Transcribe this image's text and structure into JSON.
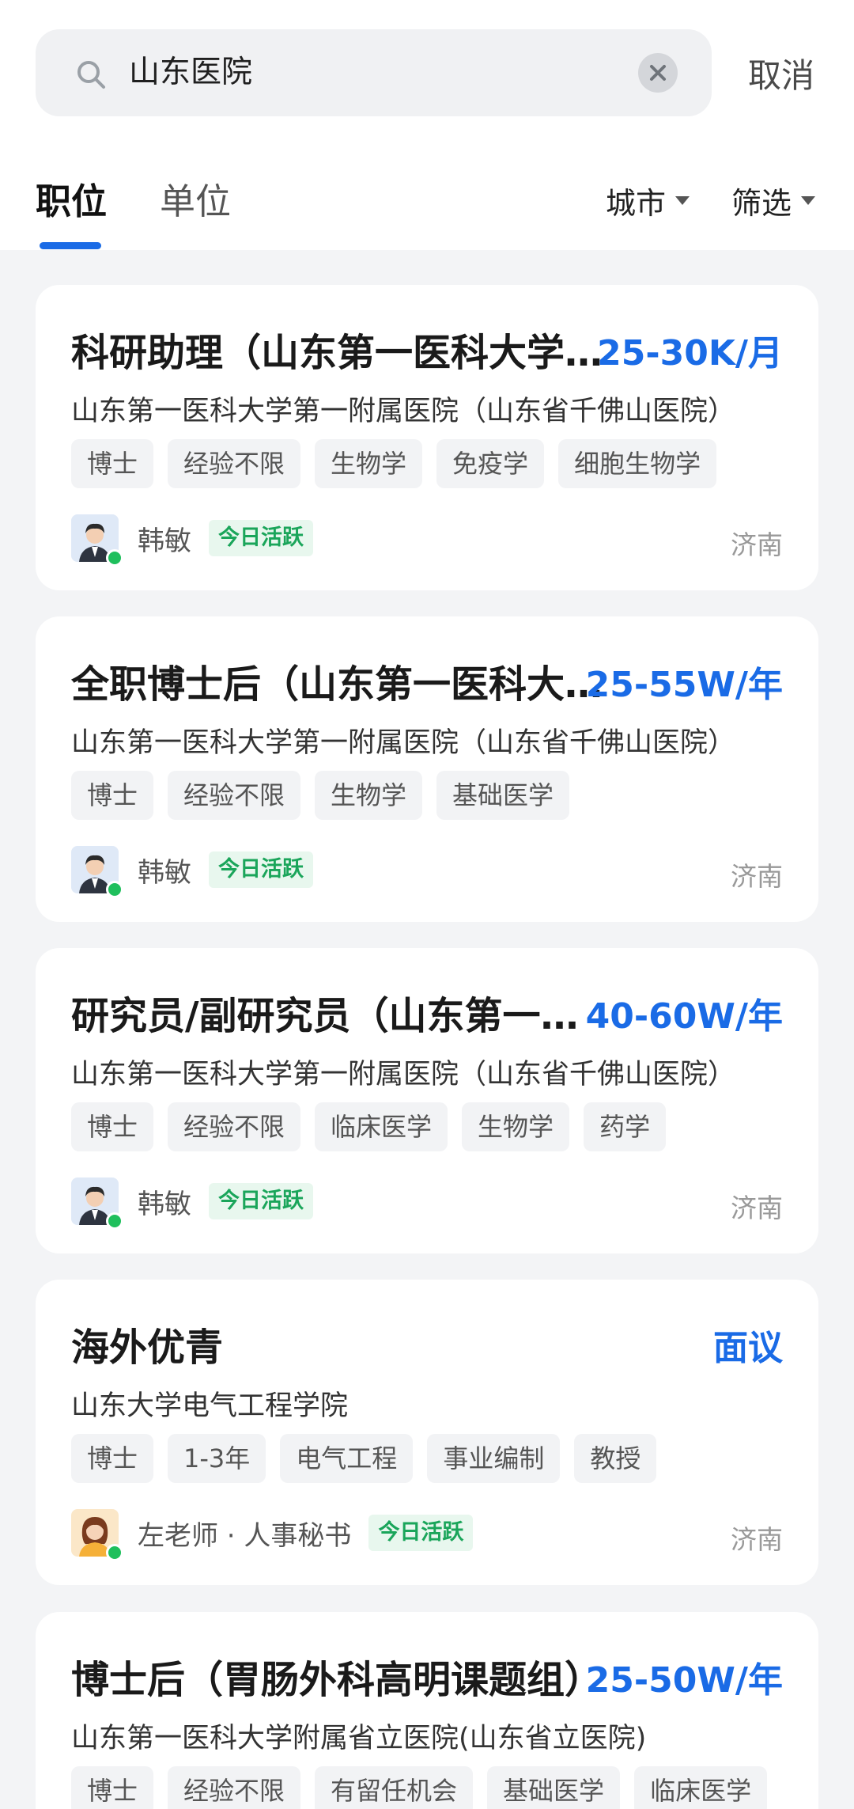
{
  "search": {
    "query": "山东医院",
    "cancel_label": "取消"
  },
  "tabs": [
    {
      "label": "职位",
      "active": true
    },
    {
      "label": "单位",
      "active": false
    }
  ],
  "filters": {
    "city_label": "城市",
    "filter_label": "筛选"
  },
  "colors": {
    "accent": "#1a6be6",
    "active_green": "#1aa55a",
    "online_dot": "#1fbf5c"
  },
  "jobs": [
    {
      "title": "科研助理（山东第一医科大学第一附属医院）",
      "salary": "25-30K/月",
      "org": "山东第一医科大学第一附属医院（山东省千佛山医院）",
      "tags": [
        "博士",
        "经验不限",
        "生物学",
        "免疫学",
        "细胞生物学"
      ],
      "recruiter": "韩敏",
      "avatar_icon": "male-avatar-icon",
      "active_badge": "今日活跃",
      "city": "济南"
    },
    {
      "title": "全职博士后（山东第一医科大学第一附属医院）",
      "salary": "25-55W/年",
      "org": "山东第一医科大学第一附属医院（山东省千佛山医院）",
      "tags": [
        "博士",
        "经验不限",
        "生物学",
        "基础医学"
      ],
      "recruiter": "韩敏",
      "avatar_icon": "male-avatar-icon",
      "active_badge": "今日活跃",
      "city": "济南"
    },
    {
      "title": "研究员/副研究员（山东第一医科大学第一附属医院）",
      "salary": "40-60W/年",
      "org": "山东第一医科大学第一附属医院（山东省千佛山医院）",
      "tags": [
        "博士",
        "经验不限",
        "临床医学",
        "生物学",
        "药学"
      ],
      "recruiter": "韩敏",
      "avatar_icon": "male-avatar-icon",
      "active_badge": "今日活跃",
      "city": "济南"
    },
    {
      "title": "海外优青",
      "salary": "面议",
      "org": "山东大学电气工程学院",
      "tags": [
        "博士",
        "1-3年",
        "电气工程",
        "事业编制",
        "教授"
      ],
      "recruiter": "左老师 · 人事秘书",
      "avatar_icon": "female-avatar-icon",
      "active_badge": "今日活跃",
      "city": "济南"
    },
    {
      "title": "博士后（胃肠外科高明课题组）",
      "salary": "25-50W/年",
      "org": "山东第一医科大学附属省立医院(山东省立医院)",
      "tags": [
        "博士",
        "经验不限",
        "有留任机会",
        "基础医学",
        "临床医学"
      ],
      "recruiter": "",
      "avatar_icon": "",
      "active_badge": "",
      "city": ""
    }
  ]
}
